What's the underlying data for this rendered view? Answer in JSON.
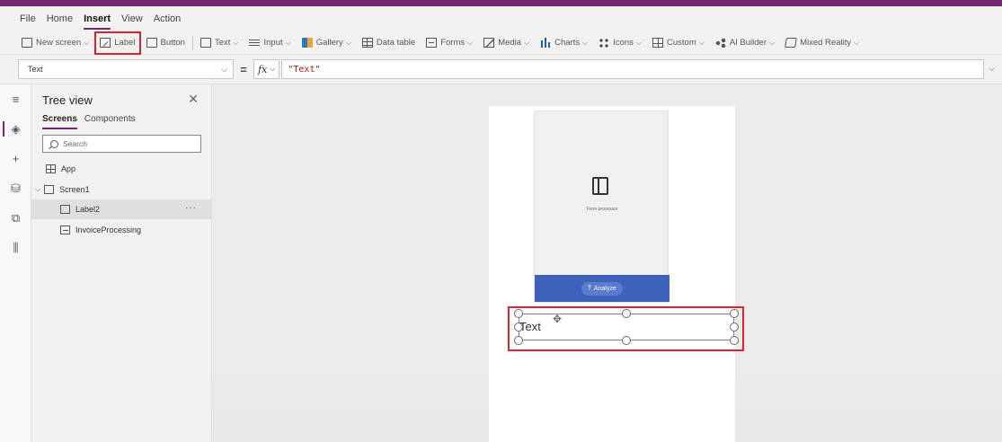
{
  "menu": [
    "File",
    "Home",
    "Insert",
    "View",
    "Action"
  ],
  "ribbon": {
    "new_screen": "New screen",
    "label": "Label",
    "button": "Button",
    "text": "Text",
    "input": "Input",
    "gallery": "Gallery",
    "data_table": "Data table",
    "forms": "Forms",
    "media": "Media",
    "charts": "Charts",
    "icons": "Icons",
    "custom": "Custom",
    "ai_builder": "AI Builder",
    "mixed_reality": "Mixed Reality"
  },
  "formula": {
    "property": "Text",
    "fx": "fx",
    "value": "\"Text\""
  },
  "tree": {
    "title": "Tree view",
    "tabs": [
      "Screens",
      "Components"
    ],
    "search_placeholder": "Search",
    "app": "App",
    "screen": "Screen1",
    "label_node": "Label2",
    "component_node": "InvoiceProcessing",
    "ellipsis": "···"
  },
  "canvas": {
    "form_caption": "Form processor",
    "analyze_label": "Analyze",
    "label_text": "Text"
  },
  "colors": {
    "accent": "#742774",
    "highlight": "#d9232e",
    "analyze_band": "#3c62b9"
  }
}
